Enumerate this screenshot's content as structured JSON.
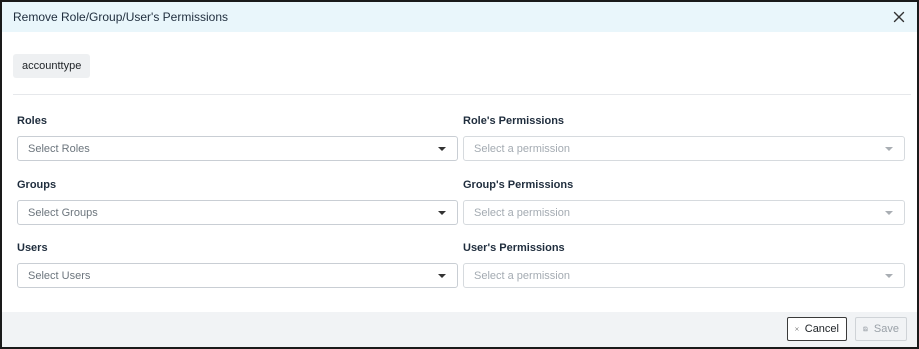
{
  "dialog": {
    "title": "Remove Role/Group/User's Permissions",
    "chip": "accounttype"
  },
  "fields": {
    "roles": {
      "label": "Roles",
      "placeholder": "Select Roles"
    },
    "role_permissions": {
      "label": "Role's Permissions",
      "placeholder": "Select a permission"
    },
    "groups": {
      "label": "Groups",
      "placeholder": "Select Groups"
    },
    "group_permissions": {
      "label": "Group's Permissions",
      "placeholder": "Select a permission"
    },
    "users": {
      "label": "Users",
      "placeholder": "Select Users"
    },
    "user_permissions": {
      "label": "User's Permissions",
      "placeholder": "Select a permission"
    }
  },
  "footer": {
    "cancel_label": "Cancel",
    "save_label": "Save"
  },
  "icons": {
    "close": "close-icon",
    "dropdown": "chevron-down-icon",
    "cancel": "close-icon",
    "save": "save-icon"
  },
  "colors": {
    "header_bg": "#e9f6fb",
    "footer_bg": "#f1f3f5",
    "chip_bg": "#eef0f2"
  }
}
